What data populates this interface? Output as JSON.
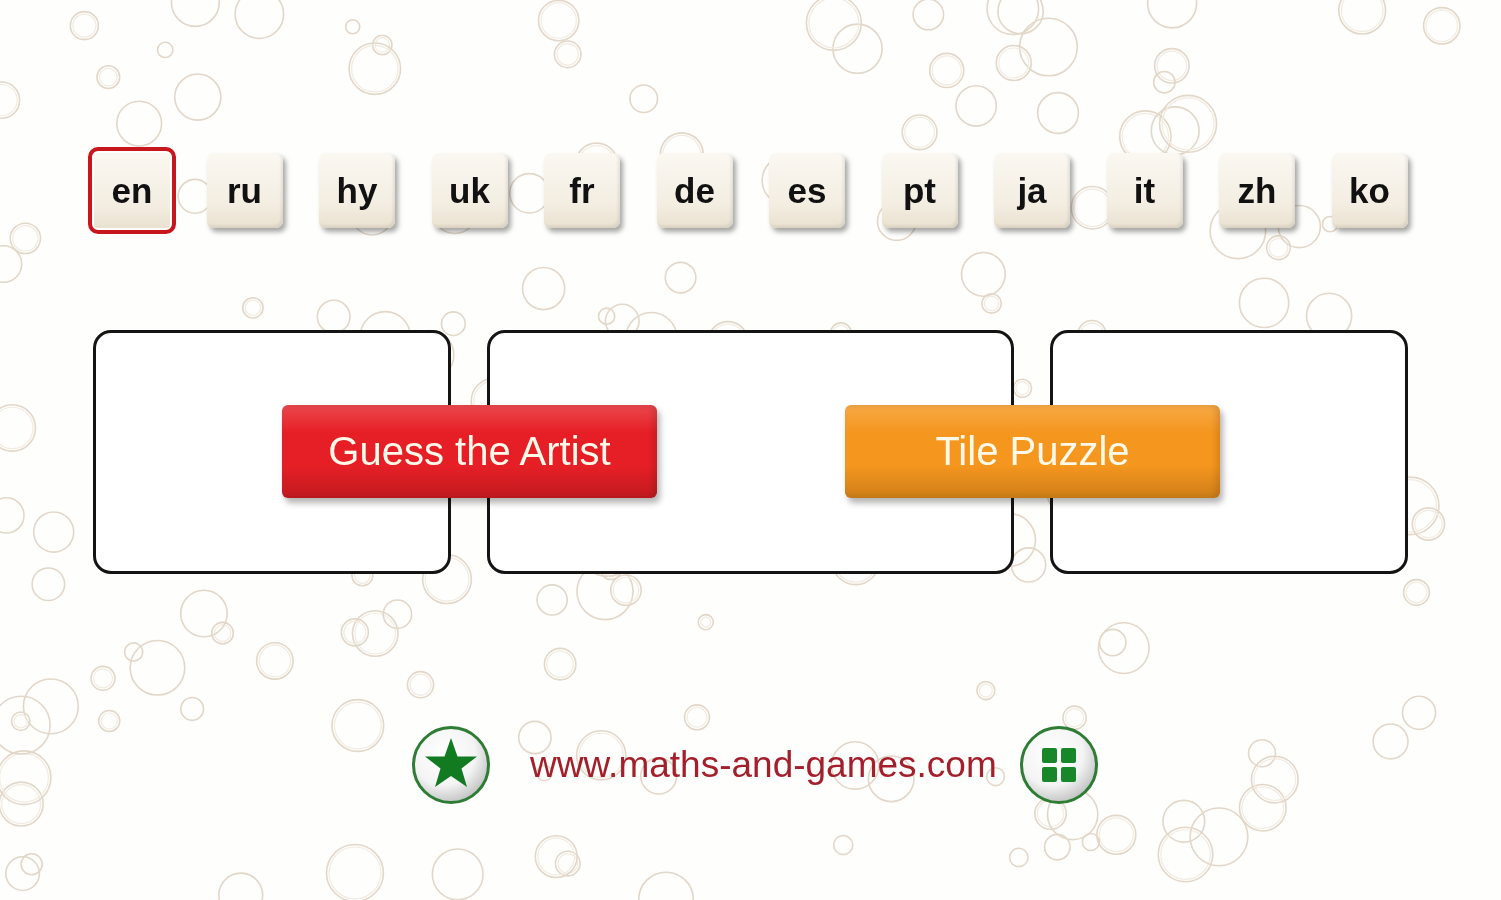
{
  "languages": [
    {
      "label": "en",
      "selected": true
    },
    {
      "label": "ru",
      "selected": false
    },
    {
      "label": "hy",
      "selected": false
    },
    {
      "label": "uk",
      "selected": false
    },
    {
      "label": "fr",
      "selected": false
    },
    {
      "label": "de",
      "selected": false
    },
    {
      "label": "es",
      "selected": false
    },
    {
      "label": "pt",
      "selected": false
    },
    {
      "label": "ja",
      "selected": false
    },
    {
      "label": "it",
      "selected": false
    },
    {
      "label": "zh",
      "selected": false
    },
    {
      "label": "ko",
      "selected": false
    }
  ],
  "games": [
    {
      "label": "Guess the Artist",
      "color": "#e61f26"
    },
    {
      "label": "Tile Puzzle",
      "color": "#f5961e"
    }
  ],
  "footer": {
    "url": "www.maths-and-games.com"
  }
}
